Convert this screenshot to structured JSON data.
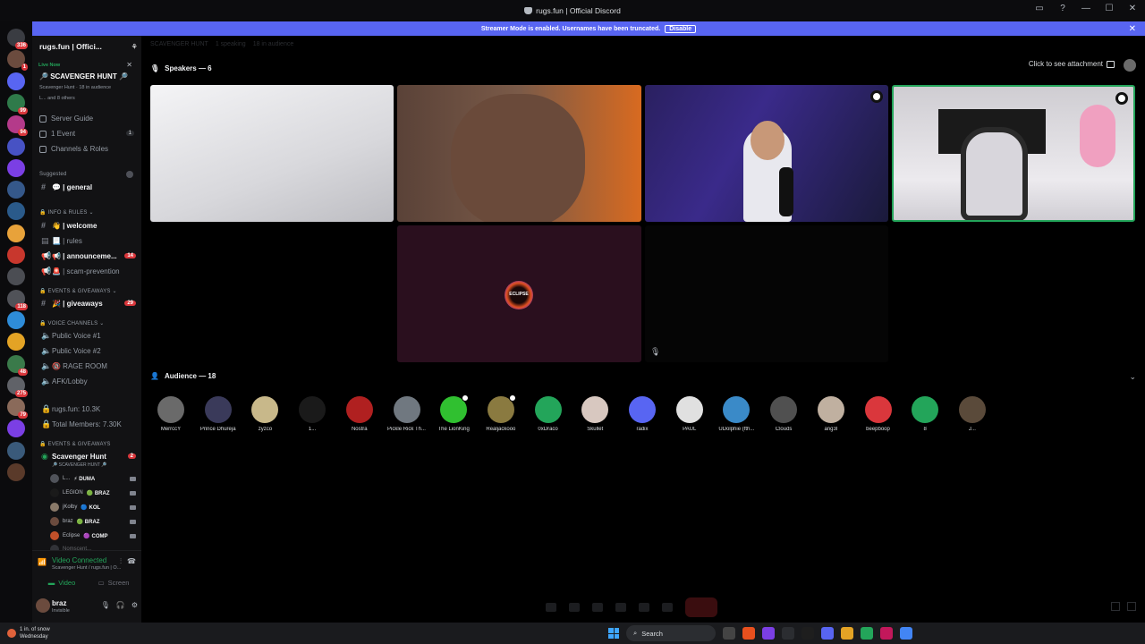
{
  "window": {
    "title": "rugs.fun | Official Discord"
  },
  "banner": {
    "text": "Streamer Mode is enabled. Usernames have been truncated.",
    "action": "Disable"
  },
  "server_list": [
    {
      "badge": "336",
      "color": "#3a3c42"
    },
    {
      "badge": "1",
      "color": "#6b4b3e"
    },
    {
      "badge": "",
      "color": "#5865f2"
    },
    {
      "badge": "99",
      "color": "#2f7a4a"
    },
    {
      "badge": "94",
      "color": "#b43a8a"
    },
    {
      "badge": "",
      "color": "#4752c4"
    },
    {
      "badge": "",
      "color": "#7b3fe4"
    },
    {
      "badge": "",
      "color": "#35588a"
    },
    {
      "badge": "",
      "color": "#2a5a8a"
    },
    {
      "badge": "",
      "color": "#e8a23a"
    },
    {
      "badge": "",
      "color": "#c8372d"
    },
    {
      "badge": "",
      "color": "#4b4d53"
    },
    {
      "badge": "118",
      "color": "#505258"
    },
    {
      "badge": "",
      "color": "#2e8cd8"
    },
    {
      "badge": "",
      "color": "#e3a325"
    },
    {
      "badge": "48",
      "color": "#3a7a4a"
    },
    {
      "badge": "275",
      "color": "#606268"
    },
    {
      "badge": "79",
      "color": "#8a6a5a"
    },
    {
      "badge": "",
      "color": "#7b3fe4"
    },
    {
      "badge": "",
      "color": "#3a5a7a"
    },
    {
      "badge": "",
      "color": "#5a3a2a"
    }
  ],
  "sidebar": {
    "server_name": "rugs.fun | Offici...",
    "live_now": "Live Now",
    "event_title": "SCAVENGER HUNT",
    "event_sub": "Scavenger Hunt · 18 in audience",
    "event_sub2": "L... and 8 others",
    "nav": [
      {
        "label": "Server Guide",
        "count": ""
      },
      {
        "label": "1 Event",
        "count": "1"
      },
      {
        "label": "Channels & Roles",
        "count": ""
      }
    ],
    "suggested_label": "Suggested",
    "suggested_channel": "💬 | general",
    "info_rules": "INFO & RULES",
    "info_channels": [
      {
        "label": "👋 | welcome",
        "bold": true,
        "count": ""
      },
      {
        "label": "📃 | rules",
        "bold": false,
        "count": ""
      },
      {
        "label": "📢 | announceme...",
        "bold": true,
        "count": "14"
      },
      {
        "label": "🚨 | scam-prevention",
        "bold": false,
        "count": ""
      }
    ],
    "events_cat": "EVENTS & GIVEAWAYS",
    "giveaways": {
      "label": "🎉 | giveaways",
      "count": "29"
    },
    "voice_cat": "VOICE CHANNELS",
    "voice_channels": [
      "Public Voice #1",
      "Public Voice #2",
      "🔞 RAGE ROOM",
      "AFK/Lobby"
    ],
    "stats": [
      "rugs.fun: 10.3K",
      "Total Members: 7.30K"
    ],
    "events_cat2": "EVENTS & GIVEAWAYS",
    "stage": {
      "label": "Scavenger Hunt",
      "sub": "🔎 SCAVENGER HUNT 🔎",
      "count": "2"
    },
    "voice_users": [
      {
        "name": "L...",
        "tag": "⚡ DUMA"
      },
      {
        "name": "LEGION",
        "tag": "🟢 BRAZ"
      },
      {
        "name": "jKolby",
        "tag": "🔵 KOL"
      },
      {
        "name": "braz",
        "tag": "🟢 BRAZ"
      },
      {
        "name": "Eclipse",
        "tag": "🟣 COMP"
      },
      {
        "name": "Nomscent...",
        "tag": ""
      }
    ],
    "vc_status": "Video Connected",
    "vc_sub": "Scavenger Hunt / rugs.fun | O...",
    "video_btn": "Video",
    "screen_btn": "Screen",
    "user_name": "braz",
    "user_status": "Invisible"
  },
  "main": {
    "breadcrumb": [
      "SCAVENGER HUNT",
      "1 speaking",
      "18 in audience"
    ],
    "speakers_label": "Speakers — 6",
    "attachment_btn": "Click to see attachment",
    "eclipse_label": "ECLIPSE",
    "audience_label": "Audience — 18",
    "audience": [
      {
        "name": "MerrccY",
        "color": "#6a6a6a"
      },
      {
        "name": "Prince Dhureja",
        "color": "#3a3a5a"
      },
      {
        "name": "zyzco",
        "color": "#c8b88a"
      },
      {
        "name": "1...",
        "color": "#1a1a1a"
      },
      {
        "name": "Nostra",
        "color": "#b02020"
      },
      {
        "name": "Pickle Rick Th...",
        "color": "#707880"
      },
      {
        "name": "The LionKing",
        "color": "#30c030"
      },
      {
        "name": "Realjackooo",
        "color": "#8a7a40"
      },
      {
        "name": "0xDraco",
        "color": "#23a55a"
      },
      {
        "name": "Skullet",
        "color": "#d8c8c0"
      },
      {
        "name": "radix",
        "color": "#5865f2"
      },
      {
        "name": "PAUL",
        "color": "#e0e0e0"
      },
      {
        "name": "UDolphie (fth...",
        "color": "#3a8ac8"
      },
      {
        "name": "Clouds",
        "color": "#505050"
      },
      {
        "name": "ang3l",
        "color": "#c0b0a0"
      },
      {
        "name": "beepboop",
        "color": "#da373c"
      },
      {
        "name": "8",
        "color": "#23a55a"
      },
      {
        "name": "J...",
        "color": "#5a4a3a"
      }
    ]
  },
  "taskbar": {
    "weather": "1 in. of snow",
    "weather_sub": "Wednesday",
    "search": "Search"
  }
}
